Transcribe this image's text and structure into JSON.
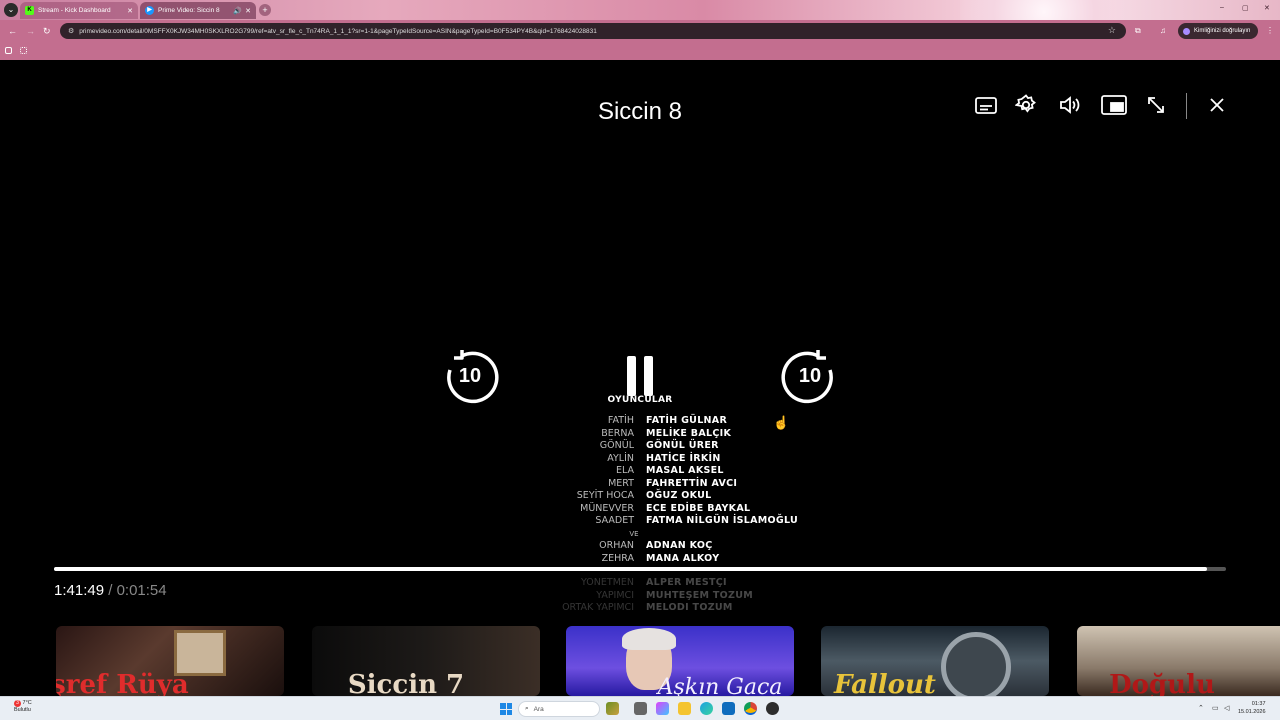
{
  "browser": {
    "tabs": [
      {
        "label": "Stream - Kick Dashboard",
        "favicon": "kick-icon",
        "close": "✕"
      },
      {
        "label": "Prime Video: Siccin 8",
        "favicon": "prime-video-icon",
        "audio": "🔊",
        "close": "✕"
      }
    ],
    "url": "primevideo.com/detail/0MSFFX0KJW34MH0SKXLRO2G799/ref=atv_sr_fle_c_Tn74RA_1_1_1?sr=1-1&pageTypeIdSource=ASIN&pageTypeId=B0F534PY4B&qid=1768424028831",
    "profile_label": "Kimliğinizi doğrulayın",
    "window_controls": {
      "minimize": "–",
      "maximize": "▢",
      "close": "✕"
    }
  },
  "player": {
    "title": "Siccin 8",
    "skip_back_label": "10",
    "skip_forward_label": "10",
    "progress_fraction": 0.984,
    "elapsed": "1:41:49",
    "separator": "/",
    "remaining": "0:01:54",
    "credits": {
      "heading": "OYUNCULAR",
      "cast": [
        {
          "role": "FATİH",
          "name": "FATİH GÜLNAR"
        },
        {
          "role": "BERNA",
          "name": "MELİKE BALÇIK"
        },
        {
          "role": "GÖNÜL",
          "name": "GÖNÜL ÜRER"
        },
        {
          "role": "AYLİN",
          "name": "HATİCE İRKİN"
        },
        {
          "role": "ELA",
          "name": "MASAL AKSEL"
        },
        {
          "role": "MERT",
          "name": "FAHRETTİN AVCI"
        },
        {
          "role": "SEYİT HOCA",
          "name": "OĞUZ OKUL"
        },
        {
          "role": "MÜNEVVER",
          "name": "ECE EDİBE BAYKAL"
        },
        {
          "role": "SAADET",
          "name": "FATMA NİLGÜN İSLAMOĞLU"
        }
      ],
      "ve": "VE",
      "cast_after": [
        {
          "role": "ORHAN",
          "name": "ADNAN KOÇ"
        },
        {
          "role": "ZEHRA",
          "name": "MANA ALKOY"
        }
      ],
      "crew": [
        {
          "role": "YÖNETMEN",
          "name": "ALPER MESTÇİ"
        },
        {
          "role": "YAPIMCI",
          "name": "MUHTEŞEM TÖZÜM"
        },
        {
          "role": "ORTAK YAPIMCI",
          "name": "MELODİ TÖZÜM"
        }
      ]
    },
    "recommendations": [
      {
        "title": "Eşref Rüya"
      },
      {
        "title": "Siccin 7"
      },
      {
        "title": "Aşkın Gaca"
      },
      {
        "title": "Fallout"
      },
      {
        "title": "Doğulu"
      }
    ]
  },
  "taskbar": {
    "weather_temp": "7°C",
    "weather_desc": "Bulutlu",
    "weather_badge": "3",
    "search_placeholder": "Ara",
    "time": "01:37",
    "date": "15.01.2026"
  }
}
